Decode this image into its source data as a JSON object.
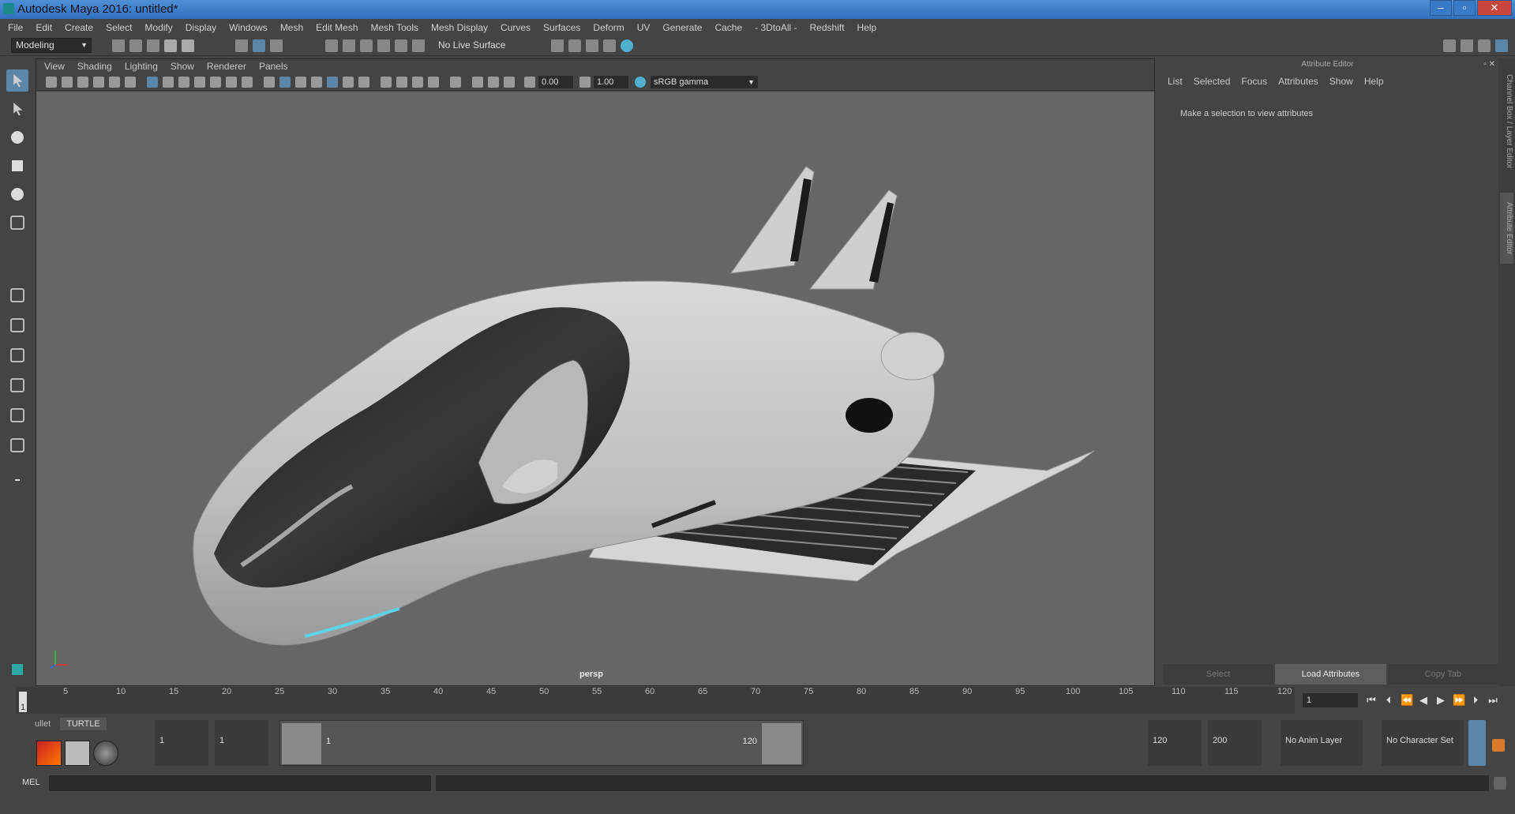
{
  "window": {
    "title": "Autodesk Maya 2016: untitled*"
  },
  "menubar": [
    "File",
    "Edit",
    "Create",
    "Select",
    "Modify",
    "Display",
    "Windows",
    "Mesh",
    "Edit Mesh",
    "Mesh Tools",
    "Mesh Display",
    "Curves",
    "Surfaces",
    "Deform",
    "UV",
    "Generate",
    "Cache",
    "- 3DtoAll -",
    "Redshift",
    "Help"
  ],
  "shelf": {
    "mode": "Modeling",
    "live_surface": "No Live Surface"
  },
  "viewport": {
    "menu": [
      "View",
      "Shading",
      "Lighting",
      "Show",
      "Renderer",
      "Panels"
    ],
    "exposure": "0.00",
    "gamma": "1.00",
    "color_space": "sRGB gamma",
    "camera_label": "persp"
  },
  "attribute_editor": {
    "title": "Attribute Editor",
    "menu": [
      "List",
      "Selected",
      "Focus",
      "Attributes",
      "Show",
      "Help"
    ],
    "message": "Make a selection to view attributes",
    "buttons": {
      "select": "Select",
      "load": "Load Attributes",
      "copy": "Copy Tab"
    },
    "side_tabs": [
      "Channel Box / Layer Editor",
      "Attribute Editor"
    ]
  },
  "timeline": {
    "ticks": [
      "5",
      "10",
      "15",
      "20",
      "25",
      "30",
      "35",
      "40",
      "45",
      "50",
      "55",
      "60",
      "65",
      "70",
      "75",
      "80",
      "85",
      "90",
      "95",
      "100",
      "105",
      "110",
      "115",
      "120"
    ],
    "current_frame": "1",
    "current_field": "1"
  },
  "range": {
    "shelf_tabs": [
      "ullet",
      "TURTLE"
    ],
    "start": "1",
    "playback_start": "1",
    "slider_start": "1",
    "slider_end": "120",
    "playback_end": "120",
    "end": "200",
    "anim_layer": "No Anim Layer",
    "character_set": "No Character Set"
  },
  "command_line": {
    "label": "MEL"
  }
}
